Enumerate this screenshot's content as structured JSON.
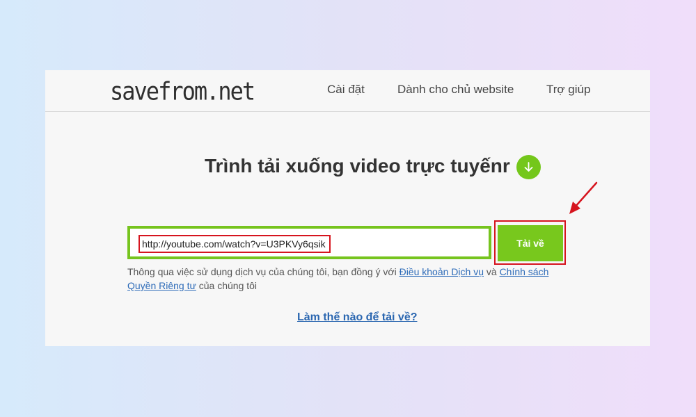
{
  "header": {
    "logo": "savefrom.net",
    "nav": [
      {
        "label": "Cài đặt"
      },
      {
        "label": "Dành cho chủ website"
      },
      {
        "label": "Trợ giúp"
      }
    ]
  },
  "hero": {
    "title": "Trình tải xuống video trực tuyếnr"
  },
  "form": {
    "url_value": "http://youtube.com/watch?v=U3PKVy6qsik",
    "download_label": "Tải về"
  },
  "terms": {
    "prefix": "Thông qua việc sử dụng dịch vụ của chúng tôi, bạn đồng ý với ",
    "terms_link": "Điều khoản Dịch vụ",
    "and": " và ",
    "privacy_link": "Chính sách Quyền Riêng tư",
    "suffix": " của chúng tôi"
  },
  "howto": {
    "label": "Làm thế nào để tải về?"
  },
  "colors": {
    "accent_green": "#76c41e",
    "highlight_red": "#d6141e",
    "link_blue": "#2a66b0"
  },
  "icons": {
    "hero": "arrow-down-circle-icon",
    "annotation": "red-arrow-icon"
  }
}
